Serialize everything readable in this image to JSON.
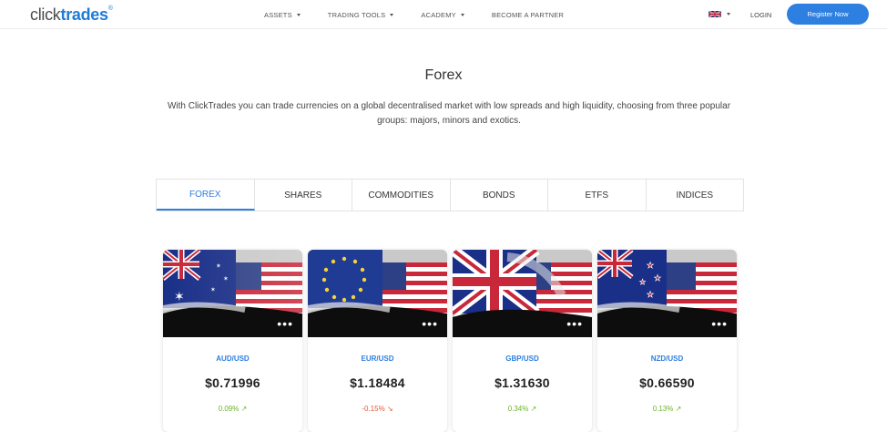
{
  "logo": {
    "part1": "click",
    "part2": "trades",
    "mark": "®"
  },
  "nav": {
    "items": [
      {
        "label": "ASSETS",
        "has_caret": true
      },
      {
        "label": "TRADING TOOLS",
        "has_caret": true
      },
      {
        "label": "ACADEMY",
        "has_caret": true
      },
      {
        "label": "BECOME A PARTNER",
        "has_caret": false
      }
    ],
    "language_icon": "uk-flag-icon",
    "login": "LOGIN",
    "register": "Register Now"
  },
  "hero": {
    "title": "Forex",
    "description": "With ClickTrades you can trade currencies on a global decentralised market with low spreads and high liquidity, choosing from three popular groups: majors, minors and exotics."
  },
  "tabs": [
    {
      "label": "FOREX",
      "active": true
    },
    {
      "label": "SHARES",
      "active": false
    },
    {
      "label": "COMMODITIES",
      "active": false
    },
    {
      "label": "BONDS",
      "active": false
    },
    {
      "label": "ETFS",
      "active": false
    },
    {
      "label": "INDICES",
      "active": false
    }
  ],
  "cards": [
    {
      "pair": "AUD/USD",
      "price": "$0.71996",
      "change": "0.09%",
      "direction": "up",
      "arrow": "↗",
      "flag": "australia-flag"
    },
    {
      "pair": "EUR/USD",
      "price": "$1.18484",
      "change": "-0.15%",
      "direction": "down",
      "arrow": "↘",
      "flag": "eu-flag"
    },
    {
      "pair": "GBP/USD",
      "price": "$1.31630",
      "change": "0.34%",
      "direction": "up",
      "arrow": "↗",
      "flag": "uk-flag"
    },
    {
      "pair": "NZD/USD",
      "price": "$0.66590",
      "change": "0.13%",
      "direction": "up",
      "arrow": "↗",
      "flag": "nz-flag"
    }
  ],
  "card_more_label": "•••",
  "colors": {
    "accent": "#2d7fe0",
    "up": "#6cb22a",
    "down": "#e05a3a"
  }
}
